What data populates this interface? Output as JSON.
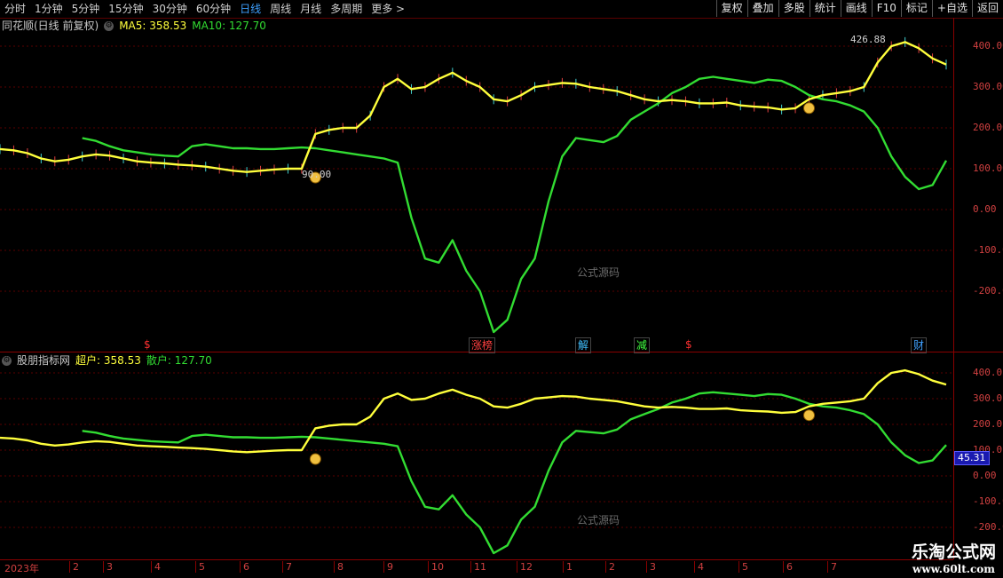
{
  "toolbar": {
    "periods": [
      "分时",
      "1分钟",
      "5分钟",
      "15分钟",
      "30分钟",
      "60分钟",
      "日线",
      "周线",
      "月线",
      "多周期",
      "更多 >"
    ],
    "active_period": "日线",
    "right_buttons": [
      "复权",
      "叠加",
      "多股",
      "统计",
      "画线",
      "F10",
      "标记",
      "+自选",
      "返回"
    ]
  },
  "main_panel": {
    "title": "同花顺(日线 前复权)",
    "ma5_label": "MA5: 358.53",
    "ma10_label": "MA10: 127.70",
    "y_ticks": [
      "400.00",
      "300.00",
      "200.00",
      "100.00",
      "0.00",
      "-100.0",
      "-200.0"
    ],
    "high_marker": "426.88",
    "low_marker": "90.00",
    "watermark": "公式源码"
  },
  "events": [
    {
      "label": "$",
      "color": "#ff3030"
    },
    {
      "label": "涨榜",
      "color": "#ff4040"
    },
    {
      "label": "解",
      "color": "#40c0ff"
    },
    {
      "label": "减",
      "color": "#40ff40"
    },
    {
      "label": "$",
      "color": "#ff3030"
    },
    {
      "label": "财",
      "color": "#40a0ff"
    }
  ],
  "sub_panel": {
    "title": "股朋指标网",
    "super_label": "超户: 358.53",
    "retail_label": "散户: 127.70",
    "y_ticks": [
      "400.0",
      "300.0",
      "200.0",
      "100.0",
      "0.00",
      "-100.0",
      "-200.0"
    ],
    "current_value": "45.31",
    "watermark": "公式源码"
  },
  "x_axis": {
    "labels": [
      "2023年",
      "2",
      "3",
      "4",
      "5",
      "6",
      "7",
      "8",
      "9",
      "10",
      "11",
      "12",
      "1",
      "2",
      "3",
      "4",
      "5",
      "6",
      "7"
    ]
  },
  "brand": {
    "line1": "乐淘公式网",
    "line2": "www.60lt.com"
  },
  "chart_data": {
    "type": "line",
    "title": "同花顺(日线 前复权)",
    "ylim_main": [
      -250,
      450
    ],
    "series": [
      {
        "name": "MA5",
        "color": "#ffff3c",
        "values": [
          148,
          145,
          138,
          125,
          118,
          122,
          130,
          135,
          132,
          125,
          118,
          115,
          113,
          110,
          108,
          105,
          100,
          95,
          92,
          95,
          98,
          100,
          100,
          185,
          195,
          200,
          200,
          230,
          300,
          320,
          295,
          300,
          320,
          335,
          315,
          300,
          270,
          265,
          280,
          300,
          305,
          310,
          308,
          300,
          295,
          290,
          280,
          270,
          265,
          268,
          265,
          260,
          260,
          262,
          255,
          252,
          250,
          245,
          248,
          270,
          280,
          285,
          290,
          300,
          360,
          400,
          410,
          395,
          370,
          355
        ]
      },
      {
        "name": "MA10",
        "color": "#32dc32",
        "values": [
          null,
          null,
          null,
          null,
          null,
          null,
          175,
          168,
          155,
          145,
          140,
          135,
          132,
          130,
          155,
          160,
          155,
          150,
          150,
          148,
          148,
          150,
          152,
          150,
          145,
          140,
          135,
          130,
          125,
          115,
          -20,
          -120,
          -130,
          -75,
          -150,
          -200,
          -300,
          -270,
          -170,
          -120,
          20,
          130,
          175,
          170,
          165,
          180,
          220,
          240,
          260,
          285,
          300,
          320,
          325,
          320,
          315,
          310,
          318,
          315,
          300,
          280,
          270,
          265,
          255,
          240,
          200,
          130,
          80,
          50,
          60,
          120
        ]
      }
    ]
  }
}
